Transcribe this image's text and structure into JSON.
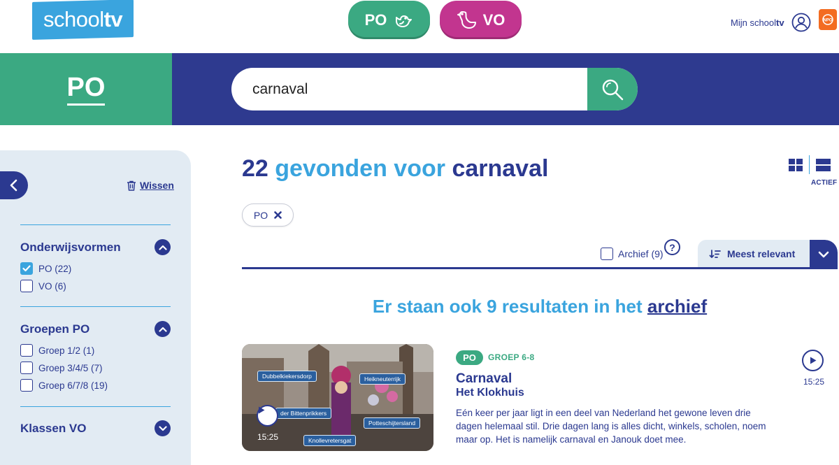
{
  "header": {
    "logo_prefix": "school",
    "logo_suffix": "tv",
    "po_label": "PO",
    "vo_label": "VO",
    "account_prefix": "Mijn school",
    "account_suffix": "tv",
    "npo_icon": "npo-logo"
  },
  "band": {
    "section_label": "PO",
    "search_value": "carnaval"
  },
  "sidebar": {
    "wissen_label": "Wissen",
    "groups": [
      {
        "title": "Onderwijsvormen",
        "expanded": true,
        "options": [
          {
            "label": "PO (22)",
            "checked": true
          },
          {
            "label": "VO (6)",
            "checked": false
          }
        ]
      },
      {
        "title": "Groepen PO",
        "expanded": true,
        "options": [
          {
            "label": "Groep 1/2 (1)",
            "checked": false
          },
          {
            "label": "Groep 3/4/5 (7)",
            "checked": false
          },
          {
            "label": "Groep 6/7/8 (19)",
            "checked": false
          }
        ]
      },
      {
        "title": "Klassen VO",
        "expanded": false,
        "options": []
      }
    ]
  },
  "main": {
    "results_count": "22",
    "results_mid": "gevonden voor",
    "results_query": "carnaval",
    "view_active_label": "ACTIEF",
    "active_filter": "PO",
    "archive_checkbox_label": "Archief (9)",
    "help_label": "?",
    "sort_label": "Meest relevant",
    "archive_msg_prefix": "Er staan ook 9 resultaten in het",
    "archive_msg_link": "archief"
  },
  "result": {
    "badge": "PO",
    "group": "GROEP 6-8",
    "title": "Carnaval",
    "series": "Het Klokhuis",
    "description": "Eén keer per jaar ligt in een deel van Nederland het gewone leven drie dagen helemaal stil. Drie dagen lang is alles dicht, winkels, scholen, noem maar op. Het is namelijk carnaval en Janouk doet mee.",
    "duration": "15:25",
    "thumb_tags": [
      "Dubbelkiekersdorp",
      "Heikneuterrijk",
      "der Bittenprikkers",
      "Potteschijtersland",
      "Knollevretersgat"
    ]
  },
  "colors": {
    "navy": "#2b3990",
    "green": "#3ba982",
    "magenta": "#c2358f",
    "sky": "#3aa4de",
    "panel": "#e2ebf3"
  }
}
